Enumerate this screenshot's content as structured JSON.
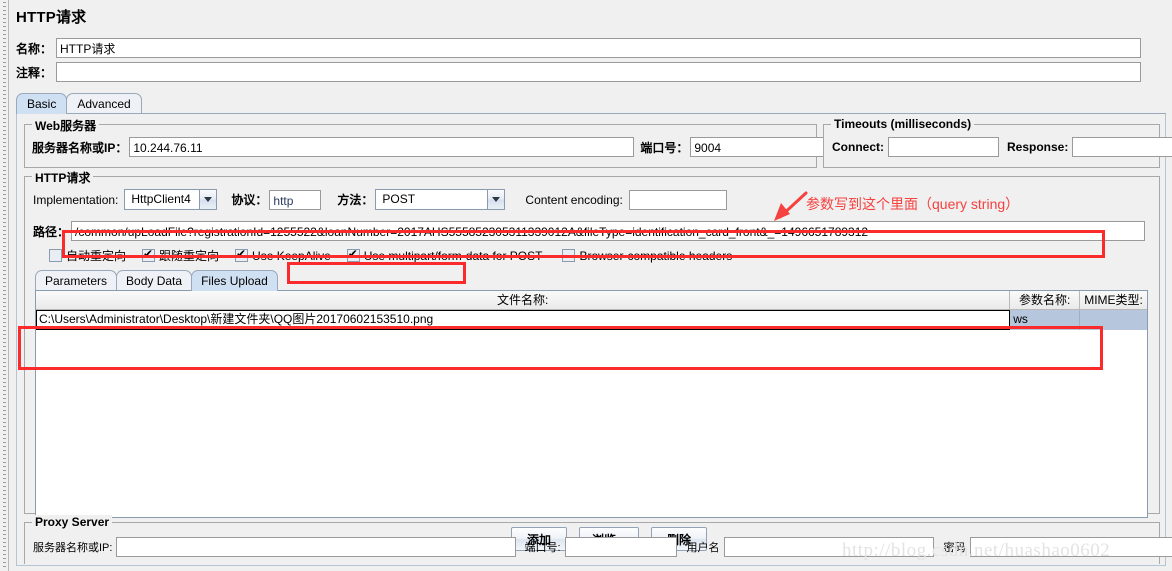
{
  "page": {
    "title": "HTTP请求"
  },
  "header": {
    "name_label": "名称：",
    "name_value": "HTTP请求",
    "comment_label": "注释：",
    "comment_value": ""
  },
  "tabs": [
    {
      "label": "Basic",
      "active": true
    },
    {
      "label": "Advanced",
      "active": false
    }
  ],
  "web_server": {
    "group_title": "Web服务器",
    "server_label": "服务器名称或IP：",
    "server_value": "10.244.76.11",
    "port_label": "端口号：",
    "port_value": "9004"
  },
  "timeouts": {
    "group_title": "Timeouts (milliseconds)",
    "connect_label": "Connect:",
    "connect_value": "",
    "response_label": "Response:",
    "response_value": ""
  },
  "http_request": {
    "group_title": "HTTP请求",
    "implementation_label": "Implementation:",
    "implementation_value": "HttpClient4",
    "protocol_label": "协议：",
    "protocol_value": "http",
    "method_label": "方法：",
    "method_value": "POST",
    "content_encoding_label": "Content encoding:",
    "content_encoding_value": "",
    "path_label": "路径：",
    "path_value": "/common/upLoadFile?registrationId=1255522&loanNumber=2017AHS555852305311339012A&fileType=identification_card_front&_=1496651789312",
    "checkboxes": [
      {
        "label": "自动重定向",
        "checked": false
      },
      {
        "label": "跟随重定向",
        "checked": true
      },
      {
        "label": "Use KeepAlive",
        "checked": true
      },
      {
        "label": "Use multipart/form-data for POST",
        "checked": true
      },
      {
        "label": "Browser-compatible headers",
        "checked": false
      }
    ]
  },
  "inner_tabs": [
    {
      "label": "Parameters",
      "active": false
    },
    {
      "label": "Body Data",
      "active": false
    },
    {
      "label": "Files Upload",
      "active": true
    }
  ],
  "files_table": {
    "columns": [
      "文件名称:",
      "参数名称:",
      "MIME类型:"
    ],
    "rows": [
      {
        "file_name": "C:\\Users\\Administrator\\Desktop\\新建文件夹\\QQ图片20170602153510.png",
        "param_name": "ws",
        "mime_type": ""
      }
    ]
  },
  "file_buttons": {
    "add": "添加",
    "browse": "浏览...",
    "delete": "删除"
  },
  "proxy_server": {
    "group_title": "Proxy Server",
    "server_label": "服务器名称或IP:",
    "server_value": "",
    "port_label": "端口号:",
    "port_value": "",
    "username_label": "用户名",
    "username_value": "",
    "password_label": "密码",
    "password_value": ""
  },
  "annotations": {
    "query_string_note": "参数写到这个里面（query string）"
  },
  "watermark": {
    "text": "http://blog.csdn.net/huashao0602"
  },
  "colors": {
    "accent_red": "#fb2b2b",
    "tab_active": "#cfe0f2",
    "selection_blue": "#b6c6dc"
  }
}
